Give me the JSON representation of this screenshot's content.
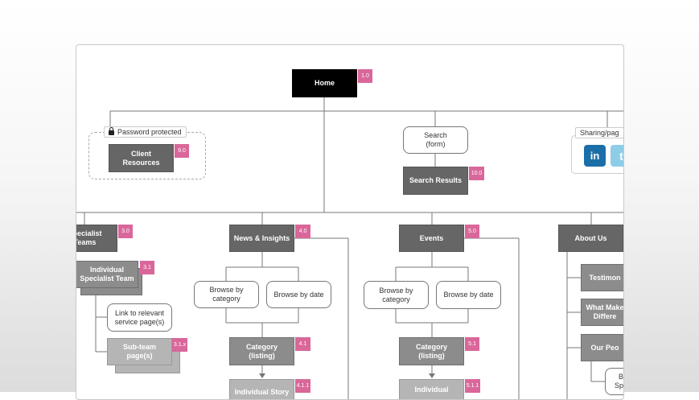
{
  "colors": {
    "black": "#000000",
    "dark": "#666666",
    "mid": "#8c8c8c",
    "light": "#b5b5b5",
    "badge": "#d9679a",
    "line": "#777777",
    "linkedin": "#1b6fa8",
    "twitter": "#8ecde8"
  },
  "nodes": {
    "home": {
      "label": "Home",
      "badge": "1.0"
    },
    "password_tag": "Password protected",
    "client": {
      "label": "Client\nResources",
      "badge": "9.0"
    },
    "search_form": "Search\n(form)",
    "search_results": {
      "label": "Search Results",
      "badge": "10.0"
    },
    "sharing_tag": "Sharing/pag",
    "linkedin_icon": "in",
    "twitter_icon": "t",
    "specialist": {
      "label": "Specialist\nTeams",
      "badge": "3.0"
    },
    "individual_specialist": {
      "label": "Individual\nSpecialist Team",
      "badge": "3.1"
    },
    "link_relevant": "Link to relevant\nservice page(s)",
    "subteam": {
      "label": "Sub-team\npage(s)",
      "badge": "3.1.x"
    },
    "news": {
      "label": "News & Insights",
      "badge": "4.0"
    },
    "news_browse_cat": "Browse by\ncategory",
    "news_browse_date": "Browse by date",
    "news_category": {
      "label": "Category\n(listing)",
      "badge": "4.1"
    },
    "news_individual": {
      "label": "Individual Story",
      "badge": "4.1.1"
    },
    "events": {
      "label": "Events",
      "badge": "5.0"
    },
    "events_browse_cat": "Browse by\ncategory",
    "events_browse_date": "Browse by date",
    "events_category": {
      "label": "Category\n(listing)",
      "badge": "5.1"
    },
    "events_individual": {
      "label": "Individual",
      "badge": "5.1.1"
    },
    "about": {
      "label": "About Us"
    },
    "testimonials": "Testimon",
    "what_makes": "What Make\nDiffere",
    "our_people": "Our Peo",
    "people_sub": "B\nSpe"
  }
}
